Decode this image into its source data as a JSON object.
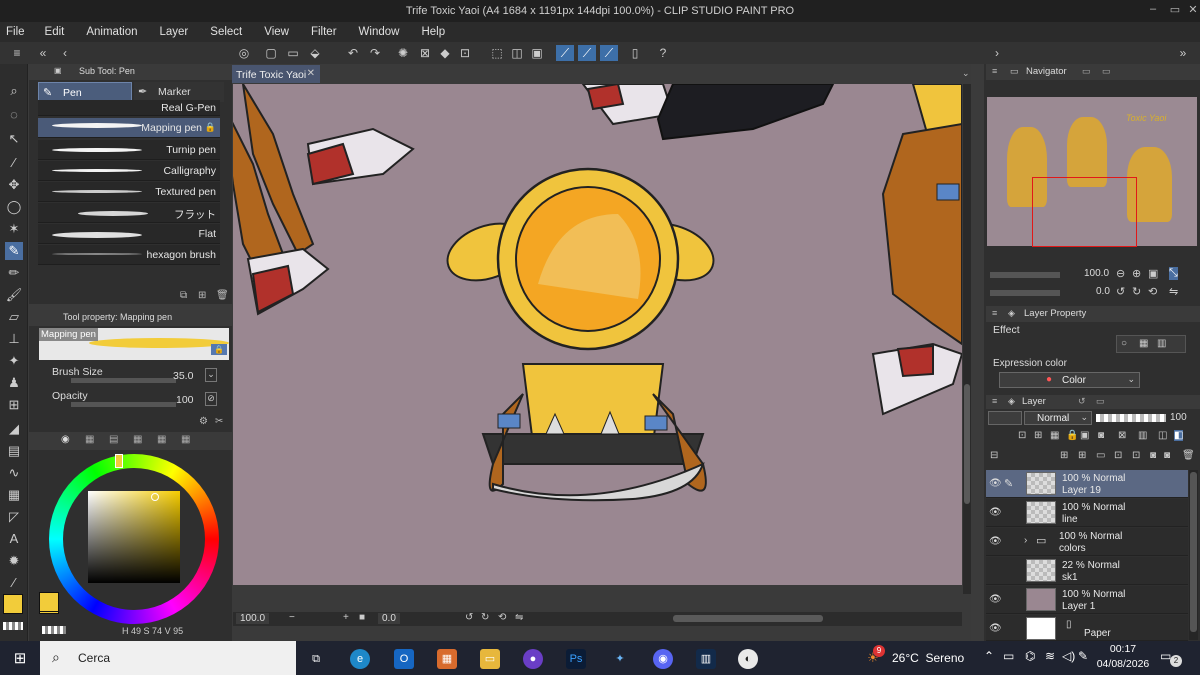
{
  "window": {
    "title": "Trife Toxic Yaoi (A4 1684 x 1191px 144dpi 100.0%)  -  CLIP STUDIO PAINT PRO"
  },
  "menu": [
    "File",
    "Edit",
    "Animation",
    "Layer",
    "Select",
    "View",
    "Filter",
    "Window",
    "Help"
  ],
  "subtool": {
    "panel_title": "Sub Tool: Pen",
    "tabs": [
      "Pen",
      "Marker"
    ],
    "brushes": [
      "Real G-Pen",
      "Mapping pen",
      "Turnip pen",
      "Calligraphy",
      "Textured pen",
      "フラット",
      "Flat",
      "hexagon brush"
    ],
    "selected": "Mapping pen"
  },
  "toolprop": {
    "panel_title": "Tool property: Mapping pen",
    "preview_label": "Mapping pen",
    "brush_size_label": "Brush Size",
    "brush_size_value": "35.0",
    "opacity_label": "Opacity",
    "opacity_value": "100"
  },
  "color": {
    "main": "#f2cc3a",
    "sub": "#f2cc3a",
    "h": "49",
    "s": "74",
    "v": "95"
  },
  "document": {
    "tab": "Trife Toxic Yaoi",
    "zoom": "100.0",
    "rotation": "0.0"
  },
  "navigator": {
    "title": "Navigator",
    "zoom": "100.0",
    "angle": "0.0",
    "caption": "Toxic Yaoi"
  },
  "layer_property": {
    "title": "Layer Property",
    "effect_label": "Effect",
    "expression_label": "Expression color",
    "expression_value": "Color"
  },
  "layers_panel": {
    "title": "Layer",
    "blend": "Normal",
    "opacity": "100",
    "layers": [
      {
        "line1": "100 % Normal",
        "line2": "Layer 19",
        "selected": true,
        "visible": true
      },
      {
        "line1": "100 % Normal",
        "line2": "line",
        "selected": false,
        "visible": true
      },
      {
        "line1": "100 % Normal",
        "line2": "colors",
        "selected": false,
        "visible": true,
        "folder": true
      },
      {
        "line1": "22 % Normal",
        "line2": "sk1",
        "selected": false,
        "visible": false
      },
      {
        "line1": "100 % Normal",
        "line2": "Layer 1",
        "selected": false,
        "visible": true,
        "color": "#9a8791"
      },
      {
        "line1": "",
        "line2": "Paper",
        "selected": false,
        "visible": true,
        "color": "#ffffff"
      }
    ]
  },
  "taskbar": {
    "search_placeholder": "Cerca",
    "weather": "26°C  Sereno",
    "weather_badge": "9",
    "time": "00:17",
    "date": "04/08/2026",
    "notifications": "2"
  }
}
